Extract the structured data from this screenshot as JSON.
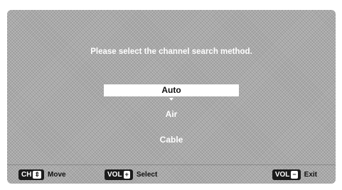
{
  "dialog": {
    "prompt": "Please select the channel search method."
  },
  "options": [
    {
      "label": "Auto",
      "selected": true
    },
    {
      "label": "Air",
      "selected": false
    },
    {
      "label": "Cable",
      "selected": false
    }
  ],
  "footer": {
    "move": {
      "key": "CH",
      "key_icon": "updown-icon",
      "label": "Move"
    },
    "select": {
      "key": "VOL",
      "key_symbol": "+",
      "label": "Select"
    },
    "exit": {
      "key": "VOL",
      "key_symbol": "−",
      "label": "Exit"
    }
  },
  "colors": {
    "background": "#a9a9a9",
    "highlight": "#ffffff",
    "key_bg": "#1b1b1b",
    "text_light": "#ffffff",
    "text_dark": "#111111"
  }
}
